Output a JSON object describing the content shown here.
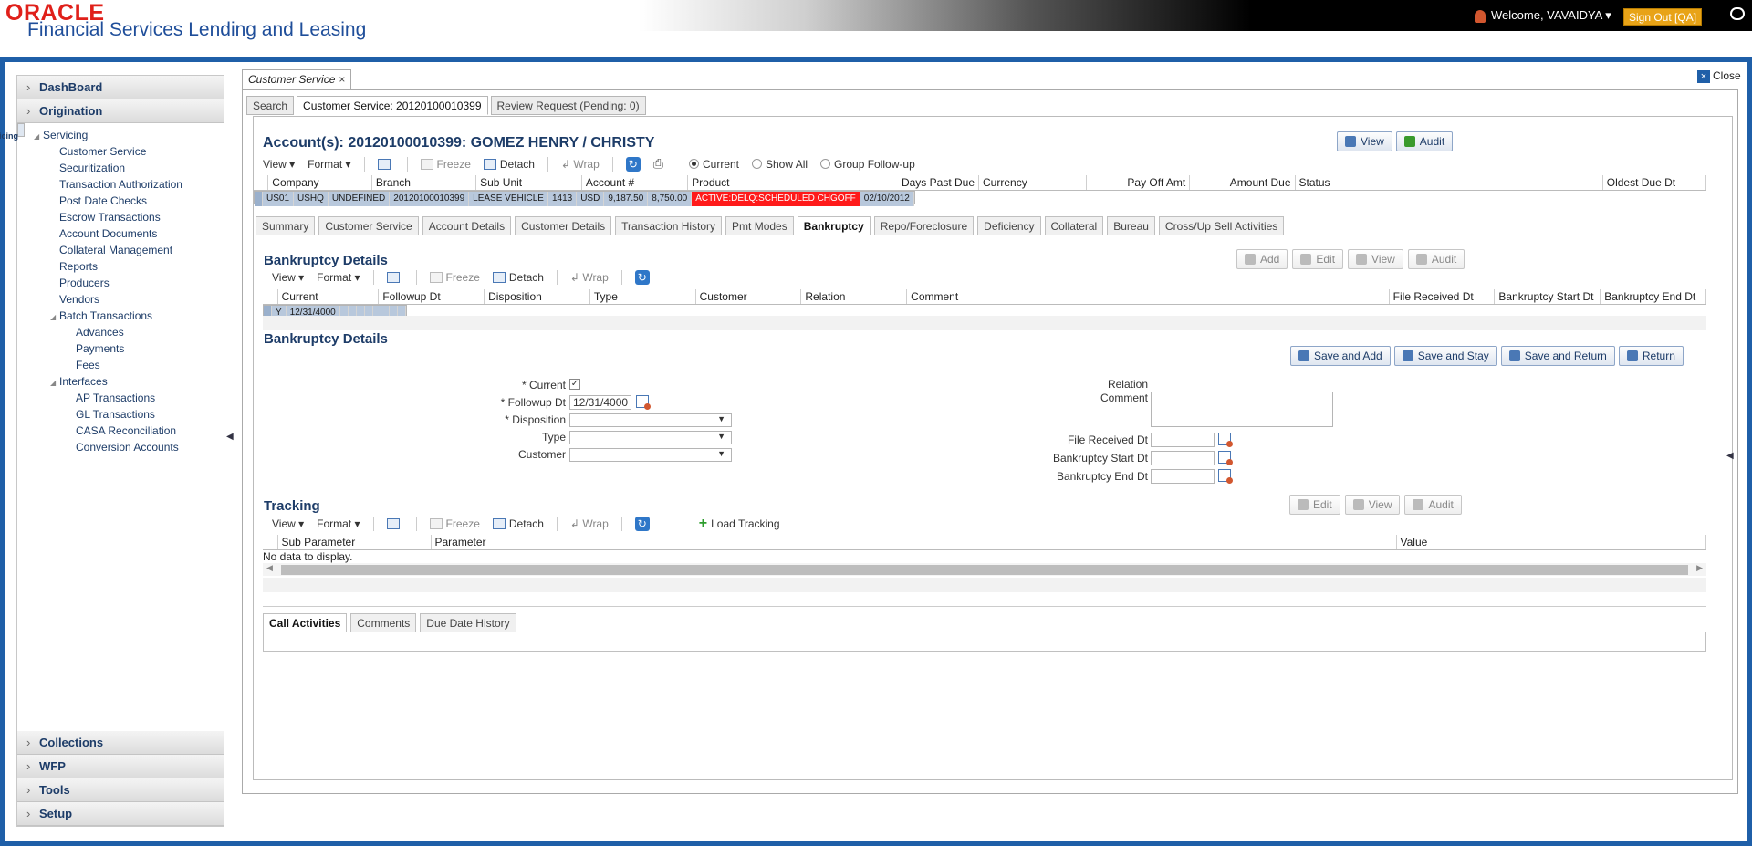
{
  "header": {
    "logo_top": "ORACLE",
    "logo_bottom": "Financial Services Lending and Leasing",
    "welcome": "Welcome, VAVAIDYA",
    "signout": "Sign Out [QA]"
  },
  "nav": {
    "top": [
      {
        "label": "DashBoard"
      },
      {
        "label": "Origination"
      },
      {
        "label": "Servicing"
      }
    ],
    "tree": [
      {
        "label": "Servicing",
        "level": 0,
        "twisty": "◢"
      },
      {
        "label": "Customer Service",
        "level": 1
      },
      {
        "label": "Securitization",
        "level": 1
      },
      {
        "label": "Transaction Authorization",
        "level": 1
      },
      {
        "label": "Post Date Checks",
        "level": 1
      },
      {
        "label": "Escrow Transactions",
        "level": 1
      },
      {
        "label": "Account Documents",
        "level": 1
      },
      {
        "label": "Collateral Management",
        "level": 1
      },
      {
        "label": "Reports",
        "level": 1
      },
      {
        "label": "Producers",
        "level": 1
      },
      {
        "label": "Vendors",
        "level": 1
      },
      {
        "label": "Batch Transactions",
        "level": 1,
        "twisty": "◢"
      },
      {
        "label": "Advances",
        "level": 2
      },
      {
        "label": "Payments",
        "level": 2
      },
      {
        "label": "Fees",
        "level": 2
      },
      {
        "label": "Interfaces",
        "level": 1,
        "twisty": "◢"
      },
      {
        "label": "AP Transactions",
        "level": 2
      },
      {
        "label": "GL Transactions",
        "level": 2
      },
      {
        "label": "CASA Reconciliation",
        "level": 2
      },
      {
        "label": "Conversion Accounts",
        "level": 2
      }
    ],
    "bottom": [
      {
        "label": "Collections"
      },
      {
        "label": "WFP"
      },
      {
        "label": "Tools"
      },
      {
        "label": "Setup"
      }
    ]
  },
  "main": {
    "top_tab": "Customer Service",
    "close": "Close",
    "sub_tabs": [
      "Search",
      "Customer Service: 20120100010399",
      "Review Request (Pending: 0)"
    ],
    "account_title": "Account(s): 20120100010399: GOMEZ HENRY / CHRISTY",
    "view_btn": "View",
    "audit_btn": "Audit",
    "toolbar": {
      "view": "View",
      "format": "Format",
      "freeze": "Freeze",
      "detach": "Detach",
      "wrap": "Wrap"
    },
    "radios": [
      "Current",
      "Show All",
      "Group Follow-up"
    ],
    "acct_table": {
      "headers": [
        "Company",
        "Branch",
        "Sub Unit",
        "Account #",
        "Product",
        "Days Past Due",
        "Currency",
        "Pay Off Amt",
        "Amount Due",
        "Status",
        "Oldest Due Dt"
      ],
      "row": [
        "US01",
        "USHQ",
        "UNDEFINED",
        "20120100010399",
        "LEASE VEHICLE",
        "1413",
        "USD",
        "9,187.50",
        "8,750.00",
        "ACTIVE:DELQ:SCHEDULED CHGOFF",
        "02/10/2012"
      ]
    },
    "content_tabs": [
      "Summary",
      "Customer Service",
      "Account Details",
      "Customer Details",
      "Transaction History",
      "Pmt Modes",
      "Bankruptcy",
      "Repo/Foreclosure",
      "Deficiency",
      "Collateral",
      "Bureau",
      "Cross/Up Sell Activities"
    ],
    "bk": {
      "title": "Bankruptcy Details",
      "btns": [
        "Add",
        "Edit",
        "View",
        "Audit"
      ],
      "headers": [
        "Current",
        "Followup Dt",
        "Disposition",
        "Type",
        "Customer",
        "Relation",
        "Comment",
        "File Received Dt",
        "Bankruptcy Start Dt",
        "Bankruptcy End Dt"
      ],
      "row": [
        "Y",
        "12/31/4000",
        "",
        "",
        "",
        "",
        "",
        "",
        "",
        ""
      ]
    },
    "form": {
      "title": "Bankruptcy Details",
      "buttons": [
        "Save and Add",
        "Save and Stay",
        "Save and Return",
        "Return"
      ],
      "labels": {
        "current": "* Current",
        "followup": "* Followup Dt",
        "disposition": "* Disposition",
        "type": "Type",
        "customer": "Customer",
        "relation": "Relation",
        "comment": "Comment",
        "file_received": "File Received Dt",
        "bk_start": "Bankruptcy Start Dt",
        "bk_end": "Bankruptcy End Dt"
      },
      "values": {
        "current": "✓",
        "followup": "12/31/4000"
      }
    },
    "tracking": {
      "title": "Tracking",
      "btns": [
        "Edit",
        "View",
        "Audit"
      ],
      "load": "Load Tracking",
      "headers": [
        "Sub Parameter",
        "Parameter",
        "Value"
      ],
      "empty": "No data to display."
    },
    "bottom_tabs": [
      "Call Activities",
      "Comments",
      "Due Date History"
    ]
  },
  "colors": {
    "brand_red": "#e0201a",
    "brand_blue": "#1f5fa8",
    "status_red": "#ff1a1a"
  }
}
